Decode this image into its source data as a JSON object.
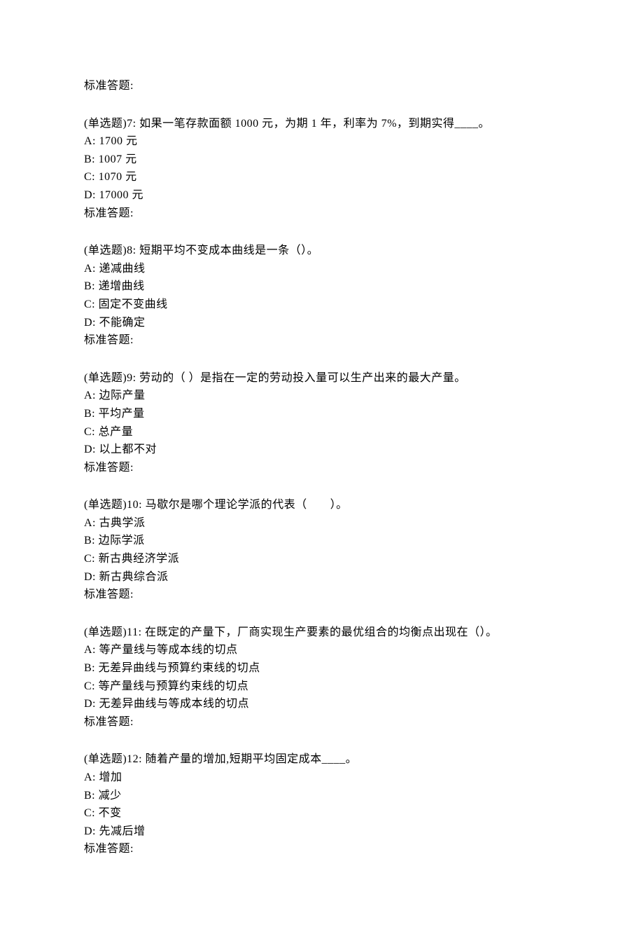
{
  "leading_answer_label": "标准答题:",
  "questions": [
    {
      "header": "(单选题)7: 如果一笔存款面额 1000 元，为期 1 年，利率为 7%，到期实得____。",
      "options": [
        "A: 1700 元",
        "B: 1007 元",
        "C: 1070 元",
        "D: 17000 元"
      ],
      "answer_label": "标准答题:"
    },
    {
      "header": "(单选题)8: 短期平均不变成本曲线是一条（）。",
      "options": [
        "A: 递减曲线",
        "B: 递增曲线",
        "C: 固定不变曲线",
        "D: 不能确定"
      ],
      "answer_label": "标准答题:"
    },
    {
      "header": "(单选题)9: 劳动的（ ）是指在一定的劳动投入量可以生产出来的最大产量。",
      "options": [
        "A: 边际产量",
        "B: 平均产量",
        "C: 总产量",
        "D: 以上都不对"
      ],
      "answer_label": "标准答题:"
    },
    {
      "header": "(单选题)10: 马歇尔是哪个理论学派的代表（　　）。",
      "options": [
        "A: 古典学派",
        "B: 边际学派",
        "C: 新古典经济学派",
        "D: 新古典综合派"
      ],
      "answer_label": "标准答题:"
    },
    {
      "header": "(单选题)11: 在既定的产量下，厂商实现生产要素的最优组合的均衡点出现在（）。",
      "options": [
        "A: 等产量线与等成本线的切点",
        "B: 无差异曲线与预算约束线的切点",
        "C: 等产量线与预算约束线的切点",
        "D: 无差异曲线与等成本线的切点"
      ],
      "answer_label": "标准答题:"
    },
    {
      "header": "(单选题)12: 随着产量的增加,短期平均固定成本____。",
      "options": [
        "A: 增加",
        "B: 减少",
        "C: 不变",
        "D: 先减后增"
      ],
      "answer_label": "标准答题:"
    }
  ]
}
